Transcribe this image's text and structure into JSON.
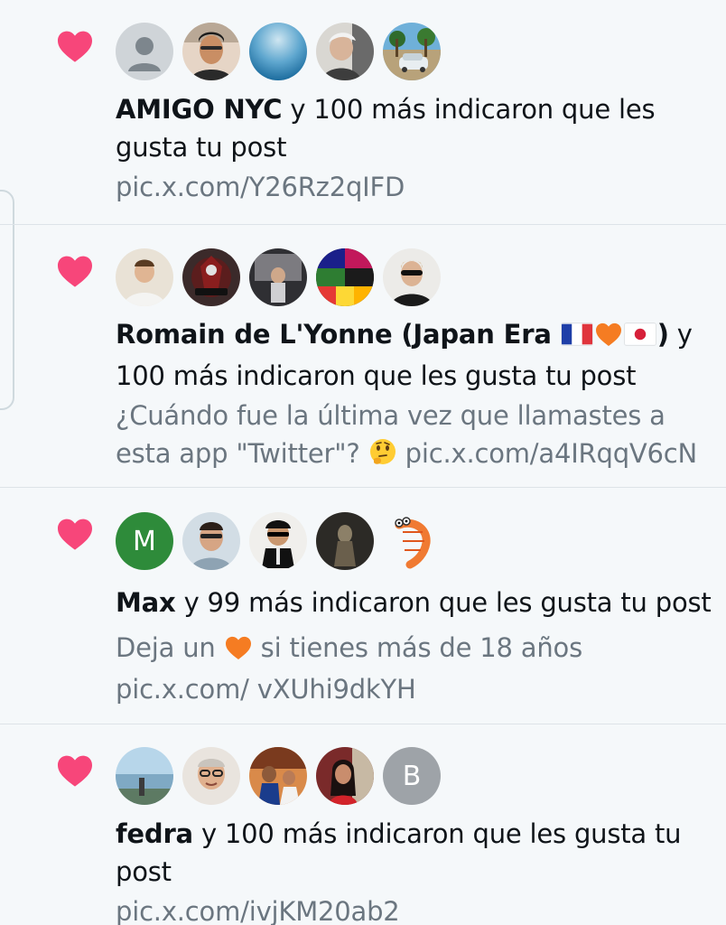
{
  "notifications": [
    {
      "name": "AMIGO NYC",
      "action": " y 100 más indicaron que les gusta tu post",
      "detail": "pic.x.com/Y26Rz2qIFD",
      "avatars": [
        "default-avatar",
        "photo",
        "blue-gradient",
        "photo",
        "photo"
      ]
    },
    {
      "name": "Romain de L'Yonne (Japan Era",
      "name_end": ")",
      "action": " y 100 más indicaron que les gusta tu post",
      "detail": "¿Cuándo fue la última vez que llamastes a esta app \"Twitter\"?",
      "detail_link": "pic.x.com/a4IRqqV6cN",
      "avatars": [
        "photo",
        "photo",
        "photo",
        "photo",
        "photo"
      ]
    },
    {
      "name": "Max",
      "action": " y 99 más indicaron que les gusta tu post",
      "detail_pre": "Deja un",
      "detail_post": "si tienes más de 18 años pic.x.com/",
      "detail_link": "vXUhi9dkYH",
      "avatars": [
        "letter-M",
        "photo",
        "photo",
        "photo",
        "shrimp"
      ],
      "letter": "M"
    },
    {
      "name": "fedra",
      "action": " y 100 más indicaron que les gusta tu",
      "action_end": "post",
      "detail": "pic.x.com/ivjKM20ab2",
      "avatars": [
        "photo",
        "photo",
        "photo",
        "photo",
        "letter-B"
      ],
      "letter": "B"
    }
  ],
  "colors": {
    "heart": "#f7467a",
    "secondary_text": "#6b7680",
    "letter_m_bg": "#2e8b3a",
    "letter_b_bg": "#9ea3a8"
  },
  "icons": {
    "heart": "heart-icon",
    "default_avatar": "person-icon",
    "emoji_thinking": "thinking-face-icon",
    "emoji_heart": "orange-heart-icon",
    "flag_fr": "france-flag-icon",
    "flag_jp": "japan-flag-icon"
  }
}
